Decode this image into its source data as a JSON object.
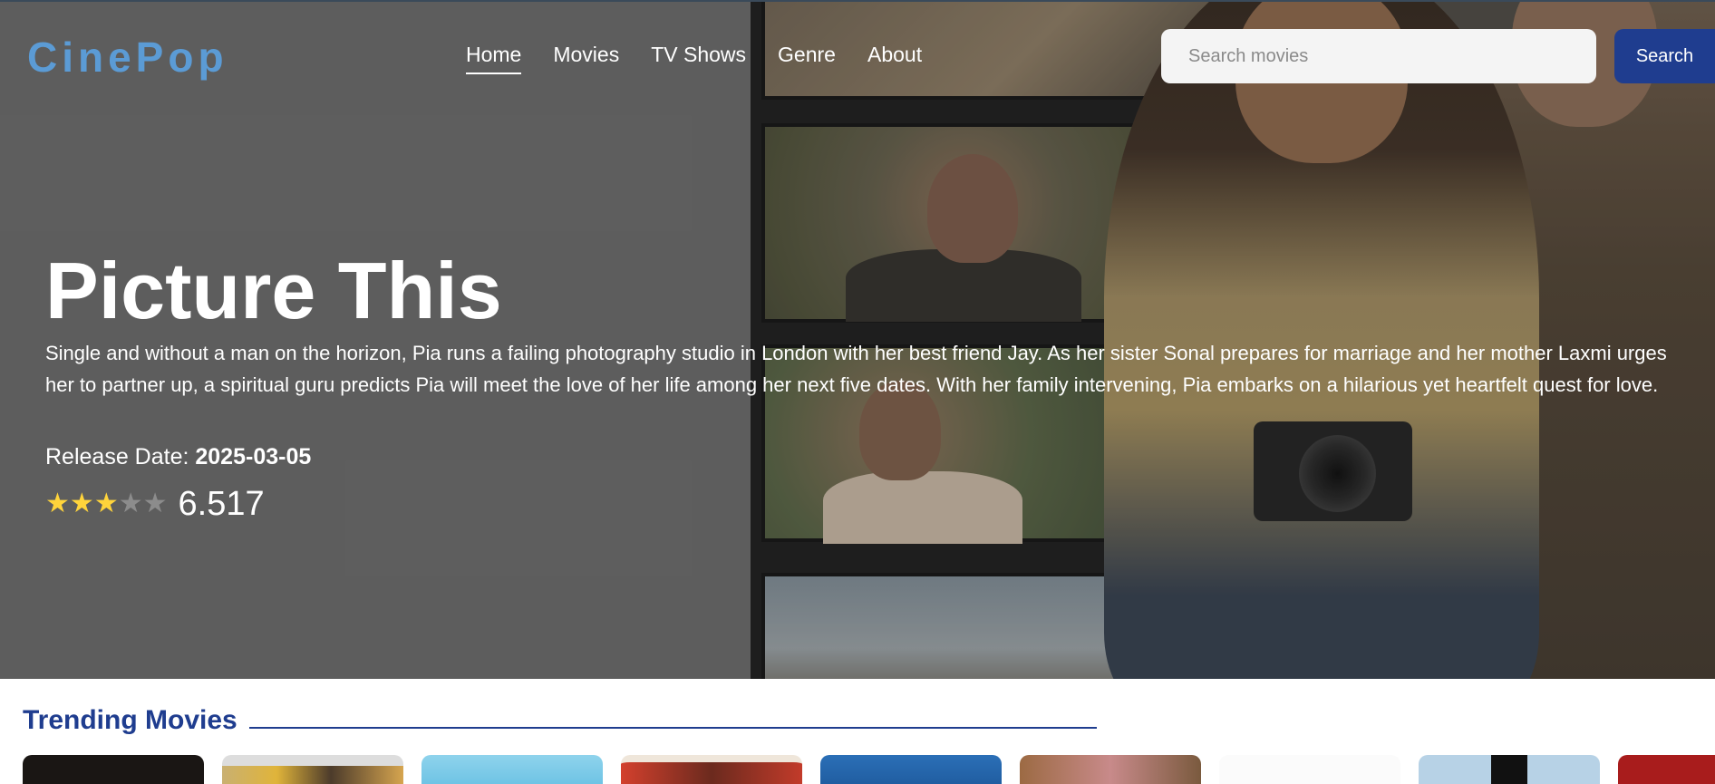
{
  "header": {
    "logo": "CinePop",
    "nav": [
      {
        "label": "Home",
        "active": true
      },
      {
        "label": "Movies"
      },
      {
        "label": "TV Shows"
      },
      {
        "label": "Genre"
      },
      {
        "label": "About"
      }
    ],
    "search": {
      "placeholder": "Search movies",
      "value": "",
      "button_label": "Search"
    }
  },
  "hero": {
    "title": "Picture This",
    "description": "Single and without a man on the horizon, Pia runs a failing photography studio in London with her best friend Jay. As her sister Sonal prepares for marriage and her mother Laxmi urges her to partner up, a spiritual guru predicts Pia will meet the love of her life among her next five dates. With her family intervening, Pia embarks on a hilarious yet heartfelt quest for love.",
    "release_label": "Release Date: ",
    "release_date": "2025-03-05",
    "stars_filled": 3,
    "stars_total": 5,
    "rating": "6.517"
  },
  "trending": {
    "title": "Trending Movies",
    "card_count": 9
  },
  "colors": {
    "logo": "#5b9bd5",
    "accent": "#1f3d8f",
    "star": "#ffd43b",
    "star_empty": "#8c8c8c"
  },
  "icons": {
    "star_filled": "★",
    "star_empty": "★"
  }
}
